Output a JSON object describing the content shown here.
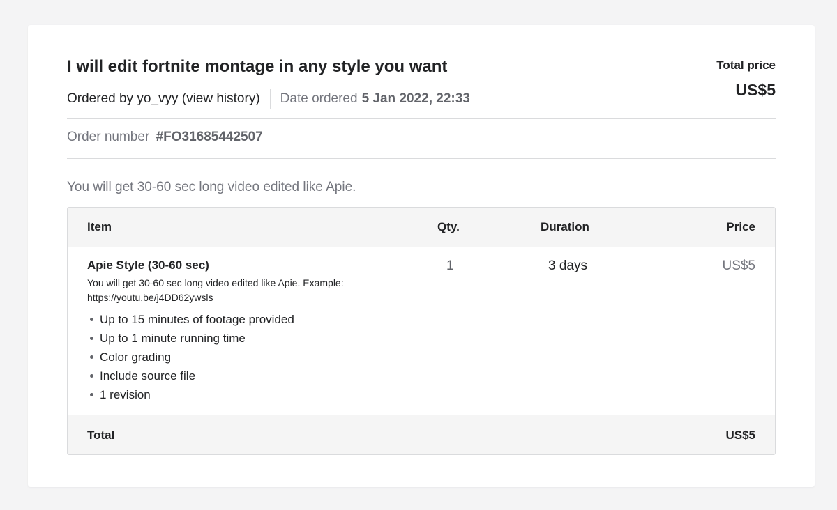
{
  "order": {
    "title": "I will edit fortnite montage in any style you want",
    "ordered_by": "Ordered by yo_vyy (view history)",
    "date_label": "Date ordered",
    "date_value": "5 Jan 2022, 22:33",
    "total_price_label": "Total price",
    "total_price_value": "US$5",
    "order_number_label": "Order number",
    "order_number_value": "#FO31685442507",
    "description": "You will get 30-60 sec long video edited like Apie."
  },
  "table": {
    "headers": {
      "item": "Item",
      "qty": "Qty.",
      "duration": "Duration",
      "price": "Price"
    },
    "row": {
      "name": "Apie Style (30-60 sec)",
      "description": "You will get 30-60 sec long video edited like Apie. Example: https://youtu.be/j4DD62ywsls",
      "features": [
        "Up to 15 minutes of footage provided",
        "Up to 1 minute running time",
        "Color grading",
        "Include source file",
        "1 revision"
      ],
      "qty": "1",
      "duration": "3 days",
      "price": "US$5"
    },
    "footer": {
      "label": "Total",
      "value": "US$5"
    }
  },
  "colors": {
    "page_background": "#f4f4f5",
    "card_background": "#ffffff",
    "primary_text": "#222325",
    "secondary_text": "#74767e",
    "border": "#dadbdd",
    "table_header_bg": "#f5f5f5"
  }
}
